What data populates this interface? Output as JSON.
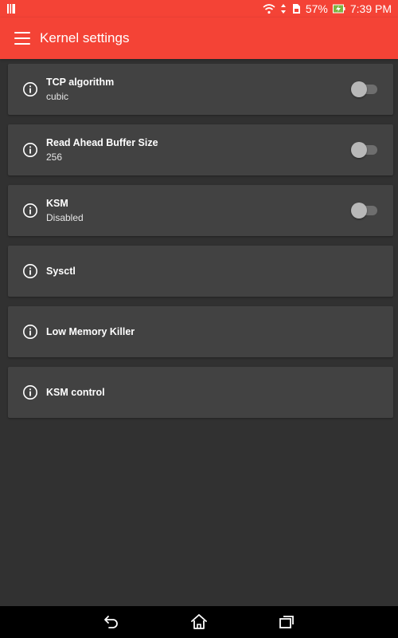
{
  "status_bar": {
    "battery": "57%",
    "time": "7:39 PM",
    "icons": [
      "notification-icon",
      "wifi-icon",
      "data-arrows-icon",
      "sd-card-icon",
      "battery-charging-icon"
    ]
  },
  "app_bar": {
    "title": "Kernel settings",
    "menu_icon": "hamburger-menu-icon",
    "background": "#f44336"
  },
  "settings": [
    {
      "title": "TCP algorithm",
      "subtitle": "cubic",
      "has_toggle": true,
      "toggle_on": false
    },
    {
      "title": "Read Ahead Buffer Size",
      "subtitle": "256",
      "has_toggle": true,
      "toggle_on": false
    },
    {
      "title": "KSM",
      "subtitle": "Disabled",
      "has_toggle": true,
      "toggle_on": false
    },
    {
      "title": "Sysctl",
      "subtitle": "",
      "has_toggle": false
    },
    {
      "title": "Low Memory Killer",
      "subtitle": "",
      "has_toggle": false
    },
    {
      "title": "KSM control",
      "subtitle": "",
      "has_toggle": false
    }
  ],
  "colors": {
    "accent": "#f44336",
    "card": "#424242",
    "background": "#313131"
  },
  "nav_bar": {
    "icons": [
      "back-icon",
      "home-icon",
      "recents-icon"
    ]
  }
}
